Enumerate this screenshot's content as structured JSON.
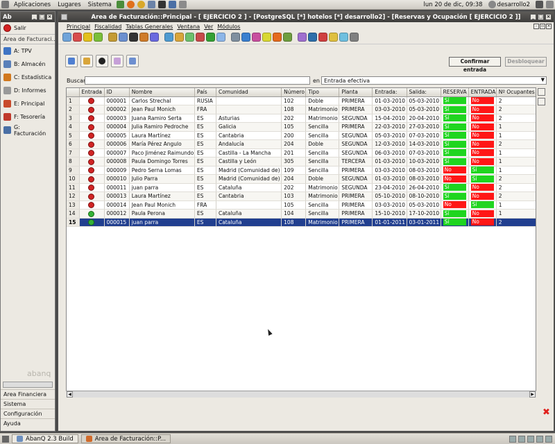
{
  "top_panel": {
    "menus": [
      "Aplicaciones",
      "Lugares",
      "Sistema"
    ],
    "clock": "lun 20 de dic, 09:38",
    "user": "desarrollo2"
  },
  "taskbar": {
    "tasks": [
      "AbanQ 2.3 Build",
      "Area de Facturación::P..."
    ]
  },
  "left_window": {
    "title": "Ab",
    "salir": "Salir",
    "area_label": "Area de Facturaci...",
    "modules": [
      {
        "label": "A: TPV",
        "color": "#3f74c4"
      },
      {
        "label": "B: Almacén",
        "color": "#5a80b9"
      },
      {
        "label": "C: Estadística",
        "color": "#d1781e"
      },
      {
        "label": "D: Informes",
        "color": "#999999"
      },
      {
        "label": "E: Principal",
        "color": "#c84a2b"
      },
      {
        "label": "F: Tesorería",
        "color": "#c0392b"
      },
      {
        "label": "G: Facturación",
        "color": "#4a6fa5"
      }
    ],
    "watermark": "abanq",
    "bottom": [
      "Area Financiera",
      "Sistema",
      "Configuración",
      "Ayuda"
    ]
  },
  "main_window": {
    "title": "Area de Facturación::Principal  - [ EJERCICIO 2 ] - [PostgreSQL [*] hotelos [*] desarrollo2] - [Reservas y Ocupación [ EJERCICIO 2 ]]",
    "menu": [
      "Principal",
      "Fiscalidad",
      "Tablas Generales",
      "Ventana",
      "Ver",
      "Módulos"
    ],
    "toolbar_colors": [
      "#6fa3d9",
      "#d84d4d",
      "#e3c11d",
      "#7bbf3a",
      "#c49b34",
      "#6b8fcf",
      "#333333",
      "#cf7c2a",
      "#6a6adf",
      "#4f9bd1",
      "#d9a53a",
      "#6cbf6c",
      "#c74a4a",
      "#35a035",
      "#8db6e8",
      "#7f8f9f",
      "#3a7fcf",
      "#c84f9f",
      "#d8d832",
      "#e56a1e",
      "#6f9e3f",
      "#9f6fcf",
      "#2e6faa",
      "#cf3f3f",
      "#dfbf3f",
      "#6fbfdf",
      "#808080"
    ],
    "confirm_label": "Confirmar entrada",
    "unlock_label": "Desbloquear",
    "search_label": "Buscar",
    "search_value": "",
    "en_label": "en",
    "field_select": "Entrada efectiva",
    "columns": [
      "",
      "Entrada",
      "ID",
      "Nombre",
      "País",
      "Comunidad",
      "Número",
      "Tipo",
      "Planta",
      "Entrada:",
      "Salida:",
      "RESERVA",
      "ENTRADA",
      "Nº Ocupantes"
    ],
    "rows": [
      {
        "n": "1",
        "status": "red",
        "id": "000001",
        "nombre": "Carlos Strechal",
        "pais": "RUSIA",
        "comunidad": "",
        "numero": "102",
        "tipo": "Doble",
        "planta": "PRIMERA",
        "entrada": "01-03-2010",
        "salida": "05-03-2010",
        "reserva": "Sí",
        "reserva_c": "green",
        "ent": "No",
        "ent_c": "red",
        "ocup": "2"
      },
      {
        "n": "2",
        "status": "red",
        "id": "000002",
        "nombre": "Jean Paul Monich",
        "pais": "FRA",
        "comunidad": "",
        "numero": "108",
        "tipo": "Matrimonio",
        "planta": "PRIMERA",
        "entrada": "03-03-2010",
        "salida": "05-03-2010",
        "reserva": "Sí",
        "reserva_c": "green",
        "ent": "No",
        "ent_c": "red",
        "ocup": "2"
      },
      {
        "n": "3",
        "status": "red",
        "id": "000003",
        "nombre": "Juana Ramiro Serta",
        "pais": "ES",
        "comunidad": "Asturias",
        "numero": "202",
        "tipo": "Matrimonio",
        "planta": "SEGUNDA",
        "entrada": "15-04-2010",
        "salida": "20-04-2010",
        "reserva": "Sí",
        "reserva_c": "green",
        "ent": "No",
        "ent_c": "red",
        "ocup": "2"
      },
      {
        "n": "4",
        "status": "red",
        "id": "000004",
        "nombre": "Julia Ramiro Pedroche",
        "pais": "ES",
        "comunidad": "Galicia",
        "numero": "105",
        "tipo": "Sencilla",
        "planta": "PRIMERA",
        "entrada": "22-03-2010",
        "salida": "27-03-2010",
        "reserva": "Sí",
        "reserva_c": "green",
        "ent": "No",
        "ent_c": "red",
        "ocup": "1"
      },
      {
        "n": "5",
        "status": "red",
        "id": "000005",
        "nombre": "Laura Martínez",
        "pais": "ES",
        "comunidad": "Cantabria",
        "numero": "200",
        "tipo": "Sencilla",
        "planta": "SEGUNDA",
        "entrada": "05-03-2010",
        "salida": "07-03-2010",
        "reserva": "Sí",
        "reserva_c": "green",
        "ent": "No",
        "ent_c": "red",
        "ocup": "1"
      },
      {
        "n": "6",
        "status": "red",
        "id": "000006",
        "nombre": "María Pérez Angulo",
        "pais": "ES",
        "comunidad": "Andalucía",
        "numero": "204",
        "tipo": "Doble",
        "planta": "SEGUNDA",
        "entrada": "12-03-2010",
        "salida": "14-03-2010",
        "reserva": "Sí",
        "reserva_c": "green",
        "ent": "No",
        "ent_c": "red",
        "ocup": "2"
      },
      {
        "n": "7",
        "status": "red",
        "id": "000007",
        "nombre": "Paco Jiménez Raimundo",
        "pais": "ES",
        "comunidad": "Castilla - La Mancha",
        "numero": "201",
        "tipo": "Sencilla",
        "planta": "SEGUNDA",
        "entrada": "06-03-2010",
        "salida": "07-03-2010",
        "reserva": "Sí",
        "reserva_c": "green",
        "ent": "No",
        "ent_c": "red",
        "ocup": "1"
      },
      {
        "n": "8",
        "status": "red",
        "id": "000008",
        "nombre": "Paula Domingo Torres",
        "pais": "ES",
        "comunidad": "Castilla y León",
        "numero": "305",
        "tipo": "Sencilla",
        "planta": "TERCERA",
        "entrada": "01-03-2010",
        "salida": "10-03-2010",
        "reserva": "Sí",
        "reserva_c": "green",
        "ent": "No",
        "ent_c": "red",
        "ocup": "1"
      },
      {
        "n": "9",
        "status": "red",
        "id": "000009",
        "nombre": "Pedro Serna Lomas",
        "pais": "ES",
        "comunidad": "Madrid (Comunidad de)",
        "numero": "109",
        "tipo": "Sencilla",
        "planta": "PRIMERA",
        "entrada": "03-03-2010",
        "salida": "08-03-2010",
        "reserva": "No",
        "reserva_c": "red",
        "ent": "Sí",
        "ent_c": "green",
        "ocup": "1"
      },
      {
        "n": "10",
        "status": "red",
        "id": "000010",
        "nombre": "Julio Parra",
        "pais": "ES",
        "comunidad": "Madrid (Comunidad de)",
        "numero": "204",
        "tipo": "Doble",
        "planta": "SEGUNDA",
        "entrada": "01-03-2010",
        "salida": "08-03-2010",
        "reserva": "No",
        "reserva_c": "red",
        "ent": "Sí",
        "ent_c": "green",
        "ocup": "2"
      },
      {
        "n": "11",
        "status": "red",
        "id": "000011",
        "nombre": "juan parra",
        "pais": "ES",
        "comunidad": "Cataluña",
        "numero": "202",
        "tipo": "Matrimonio",
        "planta": "SEGUNDA",
        "entrada": "23-04-2010",
        "salida": "26-04-2010",
        "reserva": "Sí",
        "reserva_c": "green",
        "ent": "No",
        "ent_c": "red",
        "ocup": "2"
      },
      {
        "n": "12",
        "status": "red",
        "id": "000013",
        "nombre": "Laura Martínez",
        "pais": "ES",
        "comunidad": "Cantabria",
        "numero": "103",
        "tipo": "Matrimonio",
        "planta": "PRIMERA",
        "entrada": "05-10-2010",
        "salida": "08-10-2010",
        "reserva": "Sí",
        "reserva_c": "green",
        "ent": "No",
        "ent_c": "red",
        "ocup": "2"
      },
      {
        "n": "13",
        "status": "red",
        "id": "000014",
        "nombre": "Jean Paul Monich",
        "pais": "FRA",
        "comunidad": "",
        "numero": "105",
        "tipo": "Sencilla",
        "planta": "PRIMERA",
        "entrada": "03-03-2010",
        "salida": "05-03-2010",
        "reserva": "No",
        "reserva_c": "red",
        "ent": "Sí",
        "ent_c": "green",
        "ocup": "1"
      },
      {
        "n": "14",
        "status": "green",
        "id": "000012",
        "nombre": "Paula Perona",
        "pais": "ES",
        "comunidad": "Cataluña",
        "numero": "104",
        "tipo": "Sencilla",
        "planta": "PRIMERA",
        "entrada": "15-10-2010",
        "salida": "17-10-2010",
        "reserva": "Sí",
        "reserva_c": "green",
        "ent": "No",
        "ent_c": "red",
        "ocup": "1"
      },
      {
        "n": "15",
        "status": "green",
        "id": "000015",
        "nombre": "juan parra",
        "pais": "ES",
        "comunidad": "Cataluña",
        "numero": "108",
        "tipo": "Matrimonio",
        "planta": "PRIMERA",
        "entrada": "01-01-2011",
        "salida": "03-01-2011",
        "reserva": "Sí",
        "reserva_c": "green",
        "ent": "No",
        "ent_c": "red",
        "ocup": "2",
        "selected": true
      }
    ]
  }
}
